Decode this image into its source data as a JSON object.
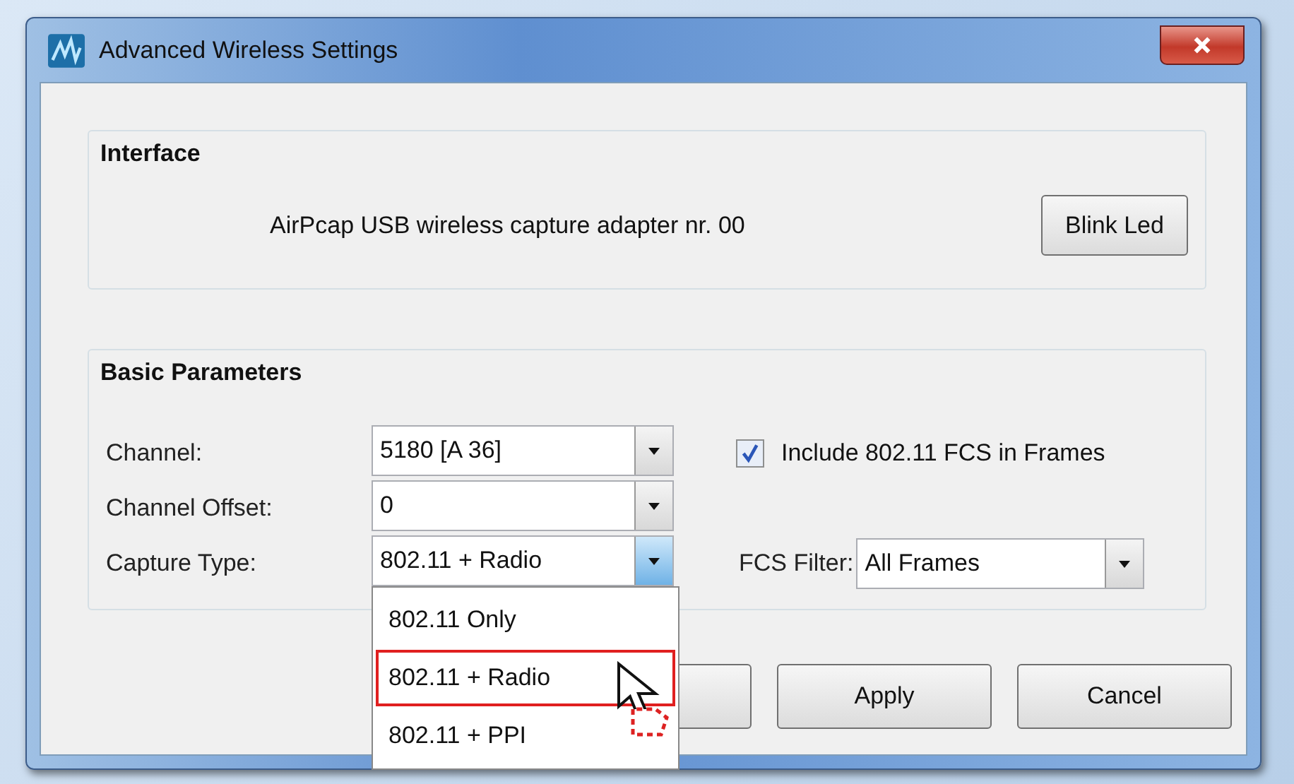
{
  "window": {
    "title": "Advanced Wireless Settings"
  },
  "interface": {
    "title": "Interface",
    "adapter": "AirPcap USB wireless capture adapter nr. 00",
    "button": "Blink Led"
  },
  "basic_parameters": {
    "title": "Basic Parameters",
    "fields": [
      {
        "label": "Channel:",
        "value": "5180 [A 36]",
        "expanded": false
      },
      {
        "label": "Channel Offset:",
        "value": "0",
        "expanded": false
      },
      {
        "label": "Capture Type:",
        "value": "802.11 + Radio",
        "expanded": true
      }
    ],
    "include_fcs": {
      "label": "Include 802.11 FCS in Frames",
      "checked": true
    },
    "fcs_filter": {
      "label": "FCS Filter:",
      "value": "All Frames"
    }
  },
  "dropdown": {
    "options": [
      {
        "label": "802.11 Only",
        "selected": false
      },
      {
        "label": "802.11 + Radio",
        "selected": true
      },
      {
        "label": "802.11 + PPI",
        "selected": false
      }
    ]
  },
  "buttons": [
    {
      "label": "Apply"
    },
    {
      "label": "Cancel"
    }
  ]
}
